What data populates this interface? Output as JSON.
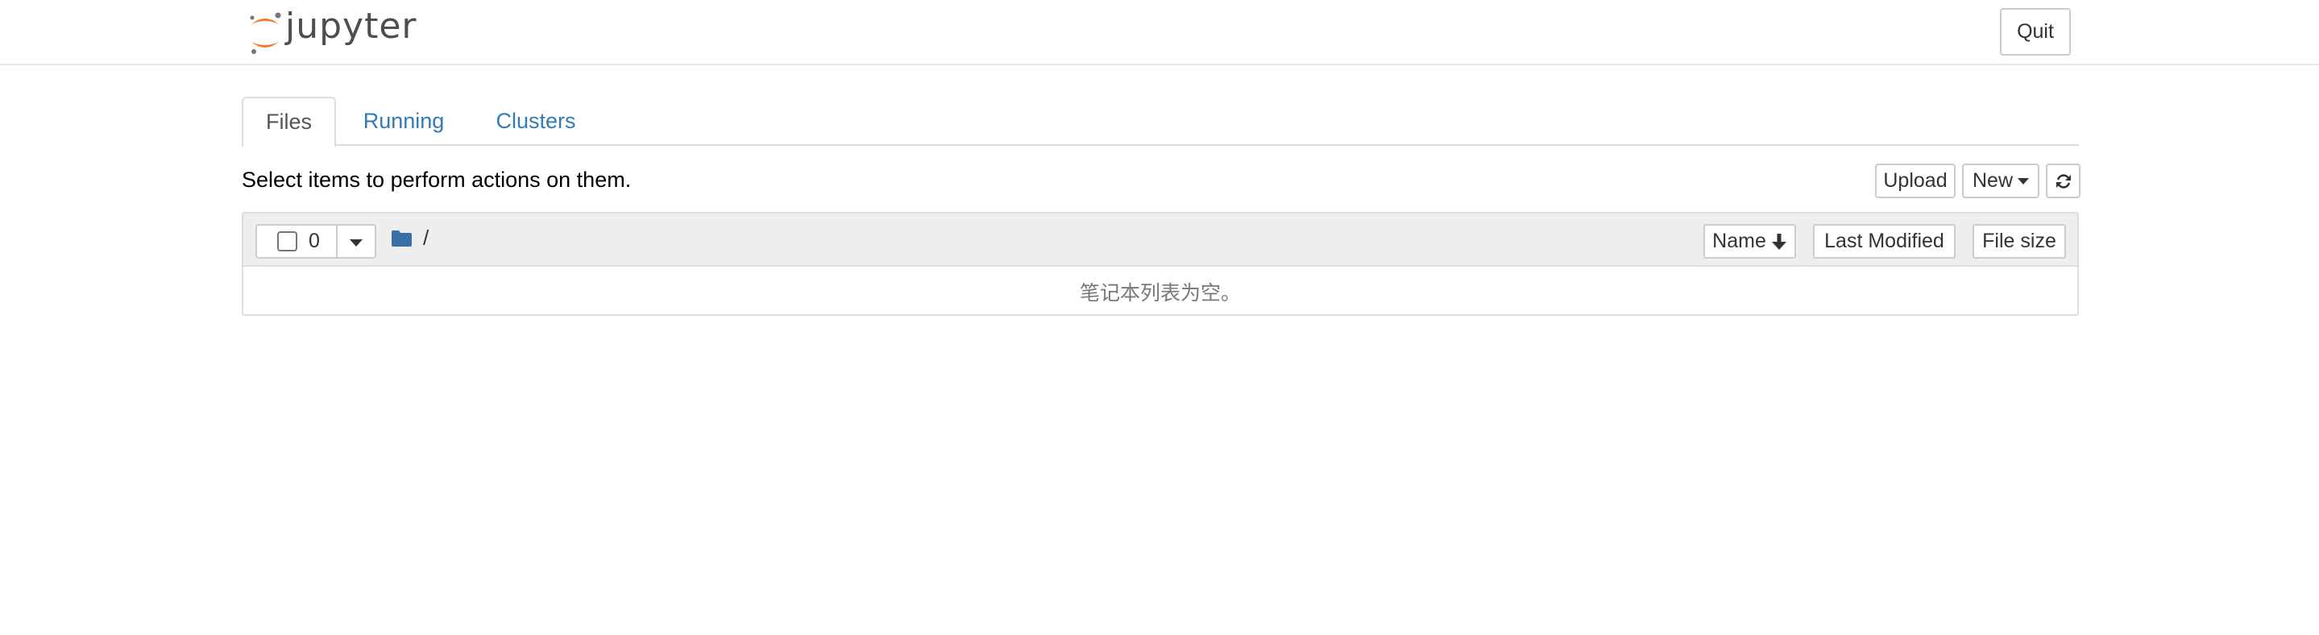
{
  "header": {
    "logo_text": "jupyter",
    "quit_label": "Quit"
  },
  "tabs": [
    {
      "label": "Files",
      "active": true
    },
    {
      "label": "Running",
      "active": false
    },
    {
      "label": "Clusters",
      "active": false
    }
  ],
  "toolbar": {
    "hint": "Select items to perform actions on them.",
    "upload_label": "Upload",
    "new_label": "New",
    "refresh_icon": "refresh-icon"
  },
  "list": {
    "selected_count": "0",
    "breadcrumb_root": "/",
    "sort_name_label": "Name",
    "sort_modified_label": "Last Modified",
    "sort_size_label": "File size",
    "empty_message": "笔记本列表为空。"
  },
  "colors": {
    "link": "#337ab7",
    "logo_orange": "#f37726",
    "logo_gray": "#767677",
    "header_border": "#e7e7e7",
    "list_header_bg": "#eeeeee"
  }
}
